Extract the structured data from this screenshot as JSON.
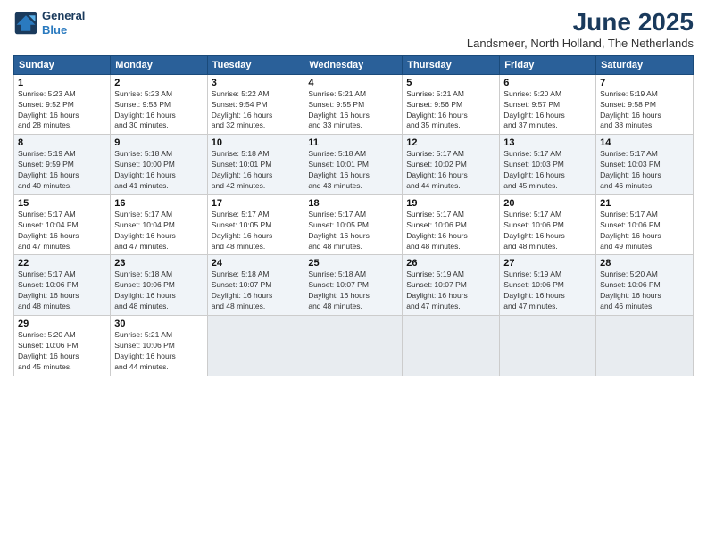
{
  "logo": {
    "line1": "General",
    "line2": "Blue"
  },
  "title": "June 2025",
  "location": "Landsmeer, North Holland, The Netherlands",
  "days_header": [
    "Sunday",
    "Monday",
    "Tuesday",
    "Wednesday",
    "Thursday",
    "Friday",
    "Saturday"
  ],
  "weeks": [
    [
      {
        "day": "1",
        "info": "Sunrise: 5:23 AM\nSunset: 9:52 PM\nDaylight: 16 hours\nand 28 minutes."
      },
      {
        "day": "2",
        "info": "Sunrise: 5:23 AM\nSunset: 9:53 PM\nDaylight: 16 hours\nand 30 minutes."
      },
      {
        "day": "3",
        "info": "Sunrise: 5:22 AM\nSunset: 9:54 PM\nDaylight: 16 hours\nand 32 minutes."
      },
      {
        "day": "4",
        "info": "Sunrise: 5:21 AM\nSunset: 9:55 PM\nDaylight: 16 hours\nand 33 minutes."
      },
      {
        "day": "5",
        "info": "Sunrise: 5:21 AM\nSunset: 9:56 PM\nDaylight: 16 hours\nand 35 minutes."
      },
      {
        "day": "6",
        "info": "Sunrise: 5:20 AM\nSunset: 9:57 PM\nDaylight: 16 hours\nand 37 minutes."
      },
      {
        "day": "7",
        "info": "Sunrise: 5:19 AM\nSunset: 9:58 PM\nDaylight: 16 hours\nand 38 minutes."
      }
    ],
    [
      {
        "day": "8",
        "info": "Sunrise: 5:19 AM\nSunset: 9:59 PM\nDaylight: 16 hours\nand 40 minutes."
      },
      {
        "day": "9",
        "info": "Sunrise: 5:18 AM\nSunset: 10:00 PM\nDaylight: 16 hours\nand 41 minutes."
      },
      {
        "day": "10",
        "info": "Sunrise: 5:18 AM\nSunset: 10:01 PM\nDaylight: 16 hours\nand 42 minutes."
      },
      {
        "day": "11",
        "info": "Sunrise: 5:18 AM\nSunset: 10:01 PM\nDaylight: 16 hours\nand 43 minutes."
      },
      {
        "day": "12",
        "info": "Sunrise: 5:17 AM\nSunset: 10:02 PM\nDaylight: 16 hours\nand 44 minutes."
      },
      {
        "day": "13",
        "info": "Sunrise: 5:17 AM\nSunset: 10:03 PM\nDaylight: 16 hours\nand 45 minutes."
      },
      {
        "day": "14",
        "info": "Sunrise: 5:17 AM\nSunset: 10:03 PM\nDaylight: 16 hours\nand 46 minutes."
      }
    ],
    [
      {
        "day": "15",
        "info": "Sunrise: 5:17 AM\nSunset: 10:04 PM\nDaylight: 16 hours\nand 47 minutes."
      },
      {
        "day": "16",
        "info": "Sunrise: 5:17 AM\nSunset: 10:04 PM\nDaylight: 16 hours\nand 47 minutes."
      },
      {
        "day": "17",
        "info": "Sunrise: 5:17 AM\nSunset: 10:05 PM\nDaylight: 16 hours\nand 48 minutes."
      },
      {
        "day": "18",
        "info": "Sunrise: 5:17 AM\nSunset: 10:05 PM\nDaylight: 16 hours\nand 48 minutes."
      },
      {
        "day": "19",
        "info": "Sunrise: 5:17 AM\nSunset: 10:06 PM\nDaylight: 16 hours\nand 48 minutes."
      },
      {
        "day": "20",
        "info": "Sunrise: 5:17 AM\nSunset: 10:06 PM\nDaylight: 16 hours\nand 48 minutes."
      },
      {
        "day": "21",
        "info": "Sunrise: 5:17 AM\nSunset: 10:06 PM\nDaylight: 16 hours\nand 49 minutes."
      }
    ],
    [
      {
        "day": "22",
        "info": "Sunrise: 5:17 AM\nSunset: 10:06 PM\nDaylight: 16 hours\nand 48 minutes."
      },
      {
        "day": "23",
        "info": "Sunrise: 5:18 AM\nSunset: 10:06 PM\nDaylight: 16 hours\nand 48 minutes."
      },
      {
        "day": "24",
        "info": "Sunrise: 5:18 AM\nSunset: 10:07 PM\nDaylight: 16 hours\nand 48 minutes."
      },
      {
        "day": "25",
        "info": "Sunrise: 5:18 AM\nSunset: 10:07 PM\nDaylight: 16 hours\nand 48 minutes."
      },
      {
        "day": "26",
        "info": "Sunrise: 5:19 AM\nSunset: 10:07 PM\nDaylight: 16 hours\nand 47 minutes."
      },
      {
        "day": "27",
        "info": "Sunrise: 5:19 AM\nSunset: 10:06 PM\nDaylight: 16 hours\nand 47 minutes."
      },
      {
        "day": "28",
        "info": "Sunrise: 5:20 AM\nSunset: 10:06 PM\nDaylight: 16 hours\nand 46 minutes."
      }
    ],
    [
      {
        "day": "29",
        "info": "Sunrise: 5:20 AM\nSunset: 10:06 PM\nDaylight: 16 hours\nand 45 minutes."
      },
      {
        "day": "30",
        "info": "Sunrise: 5:21 AM\nSunset: 10:06 PM\nDaylight: 16 hours\nand 44 minutes."
      },
      null,
      null,
      null,
      null,
      null
    ]
  ]
}
